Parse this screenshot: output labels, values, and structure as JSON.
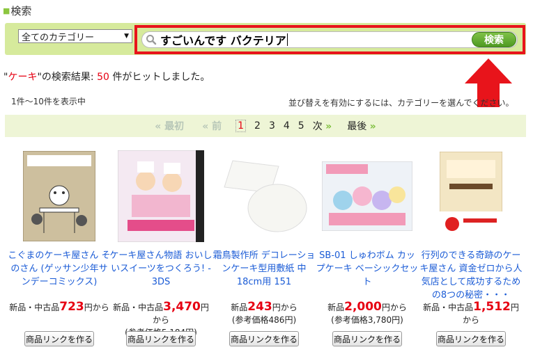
{
  "page": {
    "title": "検索"
  },
  "search": {
    "category": "全てのカテゴリー",
    "query": "すごいんです バクテリア",
    "button": "検索"
  },
  "result": {
    "prefix": "\"",
    "keyword": "ケーキ",
    "middle": "\"の検索結果: ",
    "count": "50",
    "suffix": " 件がヒットしました。"
  },
  "list_info": {
    "range": "1件〜10件を表示中",
    "sort_hint": "並び替えを有効にするには、カテゴリーを選んでください。"
  },
  "pager": {
    "first": "« 最初",
    "prev": "« 前",
    "pages": [
      "1",
      "2",
      "3",
      "4",
      "5"
    ],
    "next": "次",
    "next_mark": "»",
    "last": "最後",
    "last_mark": "»"
  },
  "products": [
    {
      "name": "こぐまのケーキ屋さん そのさん (ゲッサン少年サンデーコミックス)",
      "price_prefix": "新品・中古品",
      "price": "723",
      "price_suffix": "円から",
      "ref": "",
      "button": "商品リンクを作る"
    },
    {
      "name": "ケーキ屋さん物語 おいしいスイーツをつくろう! - 3DS",
      "price_prefix": "新品・中古品",
      "price": "3,470",
      "price_suffix": "円から",
      "ref": "(参考価格5,184円)",
      "button": "商品リンクを作る"
    },
    {
      "name": "霜鳥製作所 デコレーションケーキ型用敷紙 中 18cm用 151",
      "price_prefix": "新品",
      "price": "243",
      "price_suffix": "円から",
      "ref": "(参考価格486円)",
      "button": "商品リンクを作る"
    },
    {
      "name": "SB-01 しゅわボム カップケーキ ベーシックセット",
      "price_prefix": "新品",
      "price": "2,000",
      "price_suffix": "円から",
      "ref": "(参考価格3,780円)",
      "button": "商品リンクを作る"
    },
    {
      "name": "行列のできる奇跡のケーキ屋さん 資金ゼロから人気店として成功するための8つの秘密・・・",
      "price_prefix": "新品・中古品",
      "price": "1,512",
      "price_suffix": "円から",
      "ref": "",
      "button": "商品リンクを作る"
    }
  ],
  "colors": {
    "accent_red": "#e60012",
    "search_green": "#d6ea9c",
    "link_blue": "#1a5bd6"
  }
}
